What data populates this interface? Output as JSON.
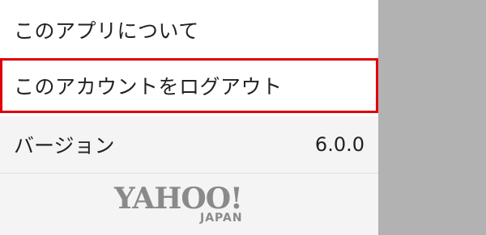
{
  "menu": {
    "about_label": "このアプリについて",
    "logout_label": "このアカウントをログアウト"
  },
  "version": {
    "label": "バージョン",
    "value": "6.0.0"
  },
  "logo": {
    "main": "YAHOO!",
    "sub": "JAPAN"
  },
  "colors": {
    "highlight_border": "#e0000b",
    "scrim": "#b2b2b2",
    "footer_bg": "#f4f4f4",
    "logo_gray": "#8a8a8a"
  }
}
